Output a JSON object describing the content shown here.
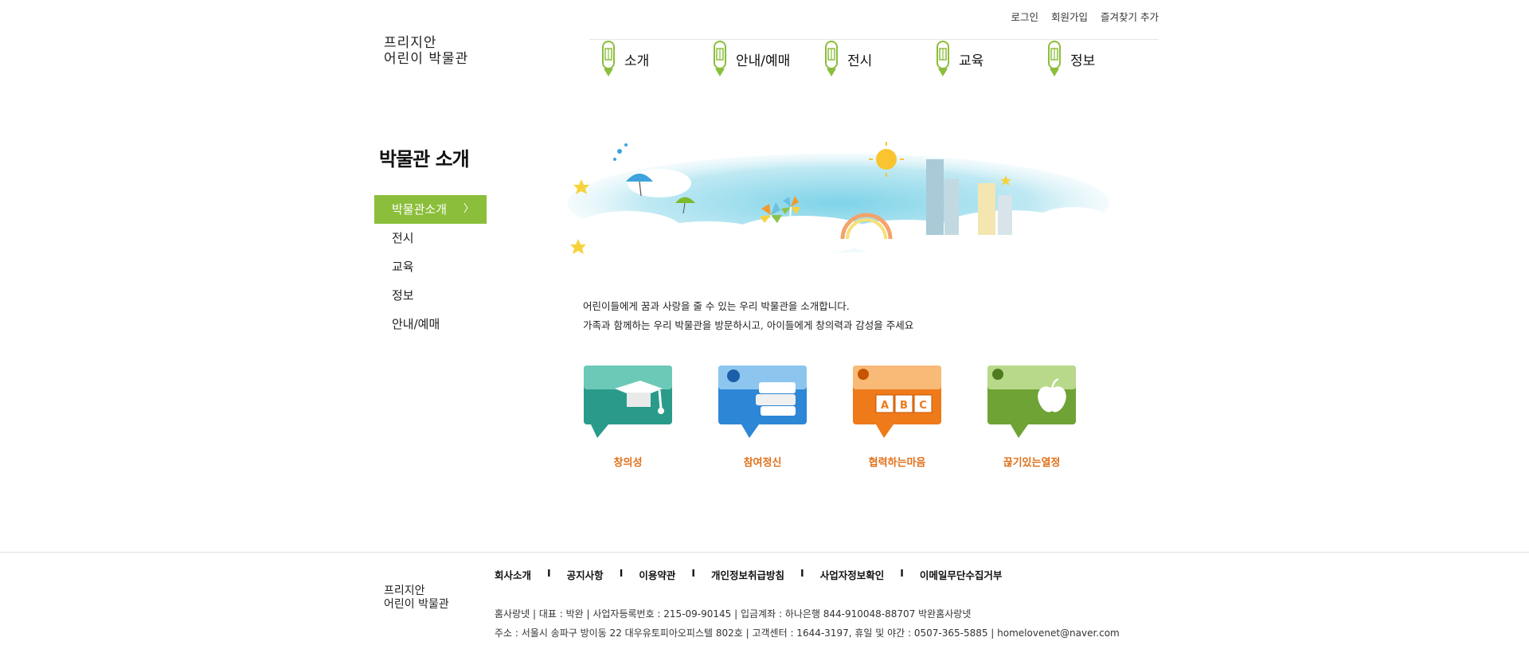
{
  "util": {
    "login": "로그인",
    "join": "회원가입",
    "bookmark": "즐겨찾기 추가"
  },
  "logo": {
    "line1": "프리지안",
    "line2": "어린이 박물관"
  },
  "gnb": [
    {
      "label": "소개"
    },
    {
      "label": "안내/예매"
    },
    {
      "label": "전시"
    },
    {
      "label": "교육"
    },
    {
      "label": "정보"
    }
  ],
  "lnb": {
    "title": "박물관 소개",
    "items": [
      {
        "label": "박물관소개",
        "active": true
      },
      {
        "label": "전시"
      },
      {
        "label": "교육"
      },
      {
        "label": "정보"
      },
      {
        "label": "안내/예매"
      }
    ],
    "arrow": "〉"
  },
  "intro": {
    "line1": "어린이들에게 꿈과 사랑을 줄 수 있는 우리 박물관을 소개합니다.",
    "line2": "가족과 함께하는 우리 박물관을 방문하시고, 아이들에게 창의력과 감성을 주세요"
  },
  "cards": [
    {
      "label": "창의성",
      "icon": "graduation-cap-icon",
      "color": "#2a9b8a"
    },
    {
      "label": "참여정신",
      "icon": "books-icon",
      "color": "#2d86d6"
    },
    {
      "label": "협력하는마음",
      "icon": "abc-blocks-icon",
      "color": "#ee7a1a"
    },
    {
      "label": "끊기있는열정",
      "icon": "apple-icon",
      "color": "#6fa336"
    }
  ],
  "footer": {
    "menu": [
      "회사소개",
      "공지사항",
      "이용약관",
      "개인정보취급방침",
      "사업자정보확인",
      "이메일무단수집거부"
    ],
    "separator": "I",
    "info1": "홈사랑넷  |  대표 : 박완  |  사업자등록번호 : 215-09-90145  |  입금계좌 : 하나은행 844-910048-88707 박완홈사랑넷",
    "info2": "주소 : 서울시 송파구 방이동 22 대우유토피아오피스텔 802호  |  고객센터 : 1644-3197, 휴일 및 야간 : 0507-365-5885  |  homelovenet@naver.com"
  },
  "colors": {
    "accent": "#8bbe3a",
    "caption": "#e0701a"
  }
}
